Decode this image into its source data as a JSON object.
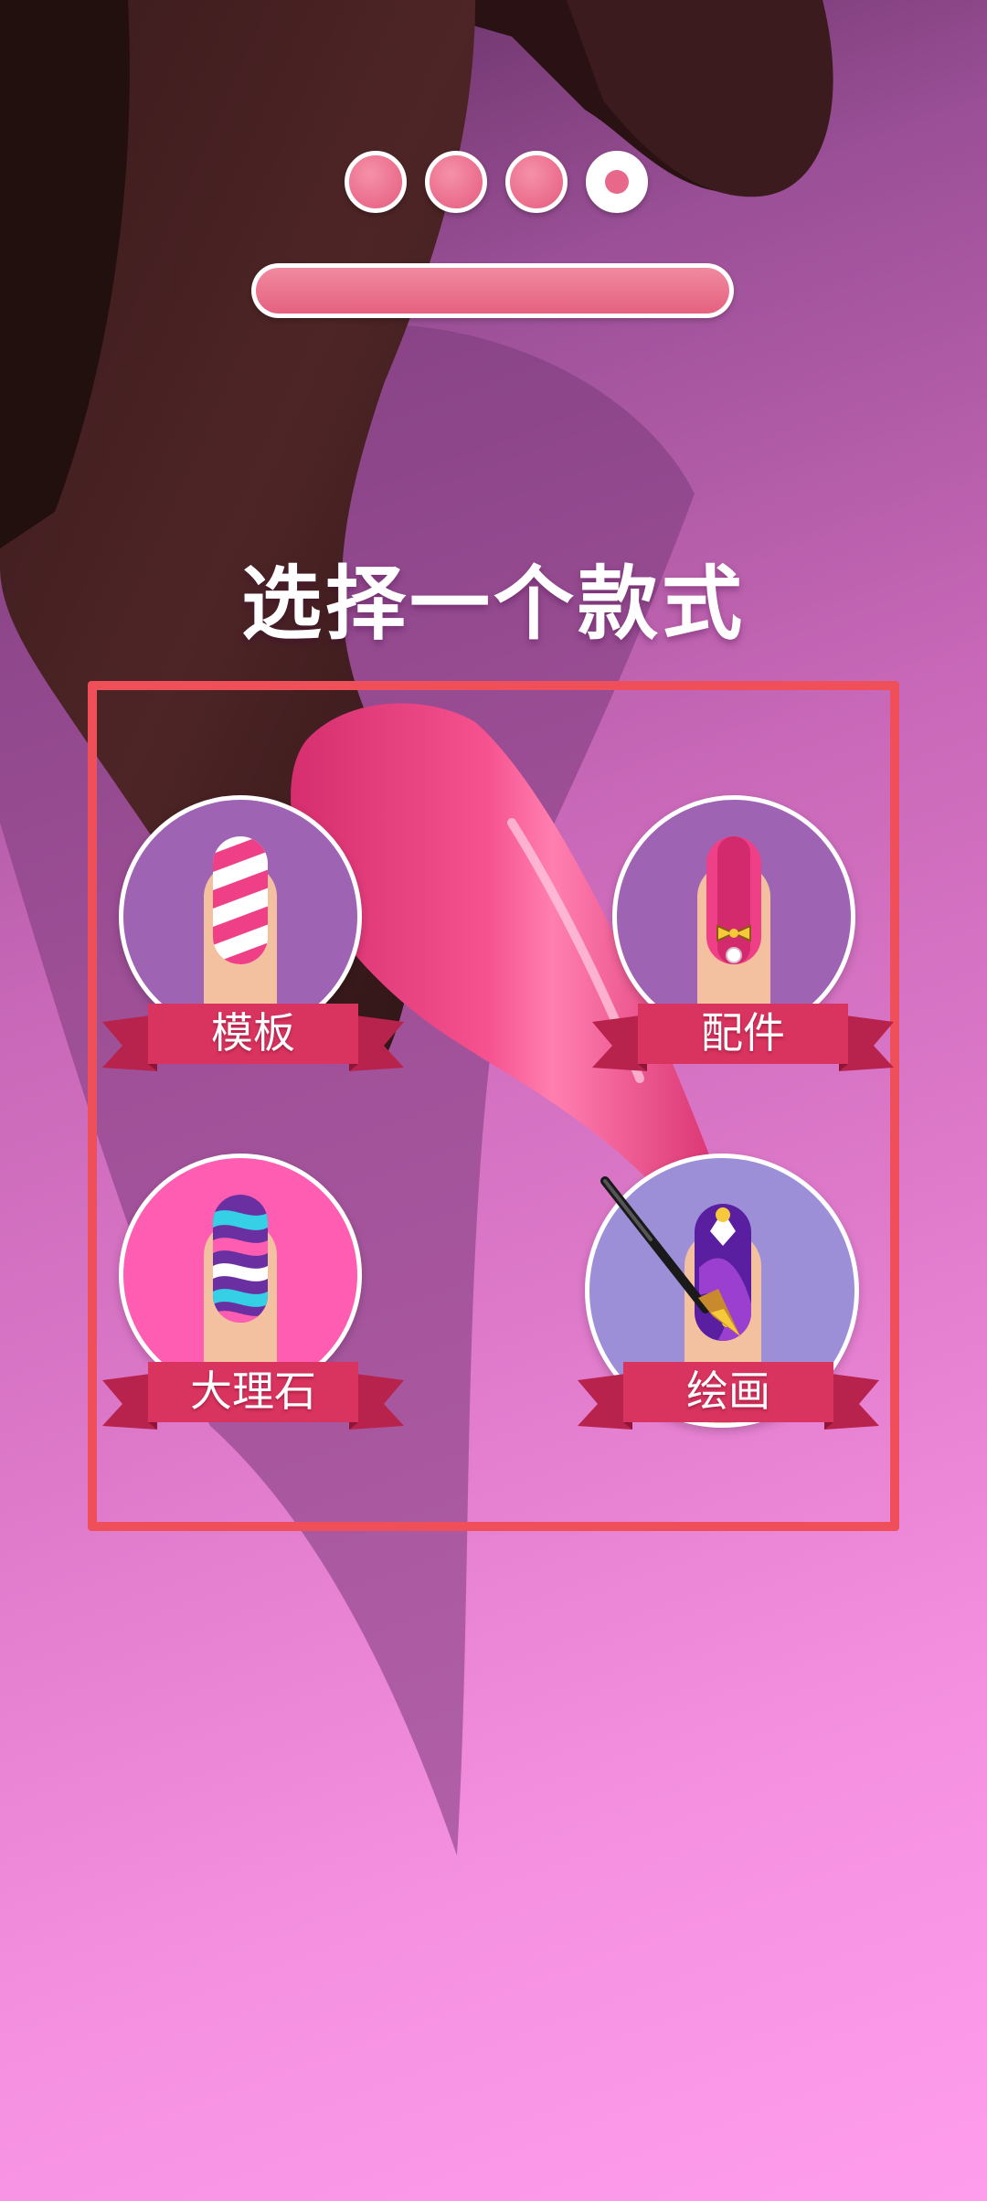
{
  "title": "选择一个款式",
  "progress": {
    "steps_total": 4,
    "current_step": 4,
    "bar_fill": 1.0
  },
  "options": [
    {
      "id": "template",
      "label": "模板",
      "icon": "striped-nail-icon"
    },
    {
      "id": "accessory",
      "label": "配件",
      "icon": "bow-gem-nail-icon"
    },
    {
      "id": "marble",
      "label": "大理石",
      "icon": "marble-nail-icon"
    },
    {
      "id": "painting",
      "label": "绘画",
      "icon": "paintbrush-nail-icon"
    }
  ],
  "colors": {
    "frame": "#ee4f59",
    "ribbon": "#d9345f",
    "accent_pink": "#e8688b",
    "nail_pink": "#ef3f86"
  }
}
